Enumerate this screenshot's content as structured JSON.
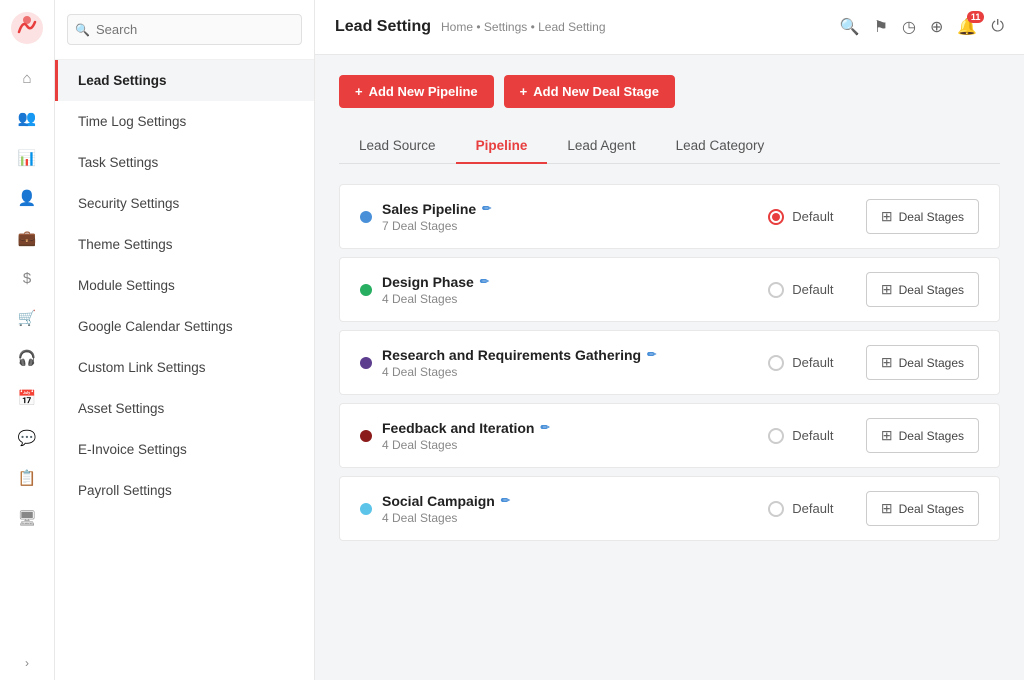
{
  "app": {
    "title": "Lead Setting",
    "breadcrumb": "Home • Settings • Lead Setting"
  },
  "header_icons": {
    "search": "🔍",
    "flag": "⚑",
    "clock": "◷",
    "plus": "⊕",
    "bell": "🔔",
    "bell_badge": "11",
    "power": "⏻"
  },
  "sidebar": {
    "search_placeholder": "Search",
    "items": [
      {
        "label": "Lead Settings",
        "active": true
      },
      {
        "label": "Time Log Settings",
        "active": false
      },
      {
        "label": "Task Settings",
        "active": false
      },
      {
        "label": "Security Settings",
        "active": false
      },
      {
        "label": "Theme Settings",
        "active": false
      },
      {
        "label": "Module Settings",
        "active": false
      },
      {
        "label": "Google Calendar Settings",
        "active": false
      },
      {
        "label": "Custom Link Settings",
        "active": false
      },
      {
        "label": "Asset Settings",
        "active": false
      },
      {
        "label": "E-Invoice Settings",
        "active": false
      },
      {
        "label": "Payroll Settings",
        "active": false
      }
    ]
  },
  "nav_icons": [
    "⌂",
    "👥",
    "📊",
    "👤",
    "💼",
    "$",
    "🛒",
    "🎧",
    "📅",
    "💬",
    "📋",
    "🖥"
  ],
  "action_buttons": [
    {
      "label": "Add New Pipeline",
      "icon": "+"
    },
    {
      "label": "Add New Deal Stage",
      "icon": "+"
    }
  ],
  "tabs": [
    {
      "label": "Lead Source",
      "active": false
    },
    {
      "label": "Pipeline",
      "active": true
    },
    {
      "label": "Lead Agent",
      "active": false
    },
    {
      "label": "Lead Category",
      "active": false
    }
  ],
  "pipelines": [
    {
      "name": "Sales Pipeline",
      "stages": "7 Deal Stages",
      "dot_color": "#4a90d9",
      "default": true
    },
    {
      "name": "Design Phase",
      "stages": "4 Deal Stages",
      "dot_color": "#27ae60",
      "default": false
    },
    {
      "name": "Research and Requirements Gathering",
      "stages": "4 Deal Stages",
      "dot_color": "#5c3d8e",
      "default": false
    },
    {
      "name": "Feedback and Iteration",
      "stages": "4 Deal Stages",
      "dot_color": "#8b1a1a",
      "default": false
    },
    {
      "name": "Social Campaign",
      "stages": "4 Deal Stages",
      "dot_color": "#5bc4e8",
      "default": false
    }
  ],
  "deal_stages_btn": "Deal Stages"
}
